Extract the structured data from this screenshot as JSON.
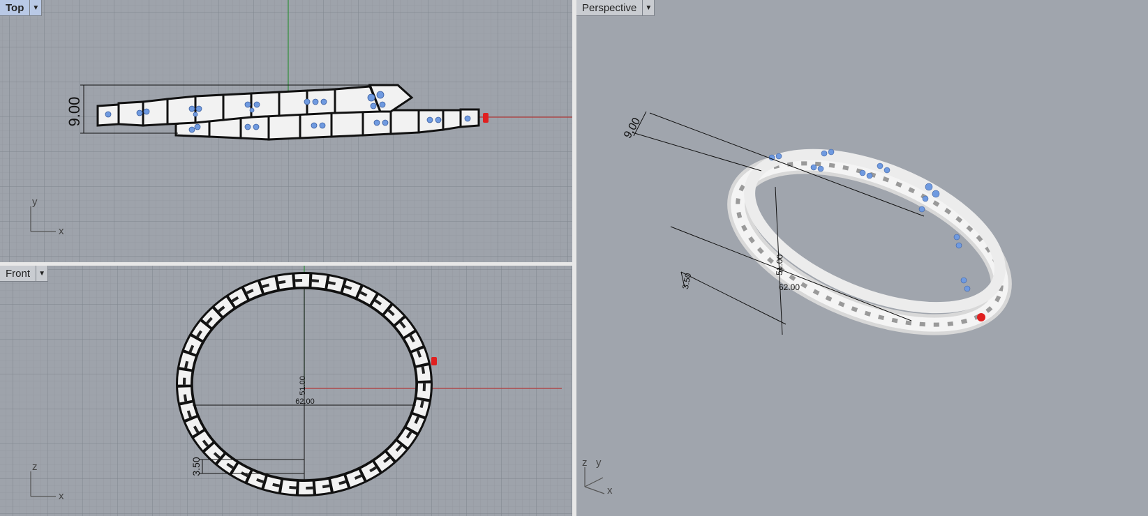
{
  "viewports": {
    "top": {
      "title": "Top",
      "axis_x": "x",
      "axis_y": "y",
      "dimension": "9.00"
    },
    "front": {
      "title": "Front",
      "axis_x": "x",
      "axis_z": "z",
      "dim_height": "51.00",
      "dim_width": "62.00",
      "dim_thickness": "3.50"
    },
    "perspective": {
      "title": "Perspective",
      "axis_x": "x",
      "axis_y": "y",
      "axis_z": "z",
      "dim_width": "9.00",
      "dim_height": "51.00",
      "dim_diameter": "62.00",
      "dim_thickness": "3.50"
    }
  },
  "colors": {
    "viewport_bg": "#9ea3ab",
    "grid_minor": "#8f949c",
    "grid_major": "#7f848c",
    "x_axis": "#b33a3a",
    "y_axis": "#2f8f3a",
    "gem": "#6f9ae0",
    "marker": "#e02020",
    "active_tab": "#b9c9e6"
  },
  "icons": {
    "dropdown": "triangle-down",
    "axis_widget": "cplane-axes"
  }
}
